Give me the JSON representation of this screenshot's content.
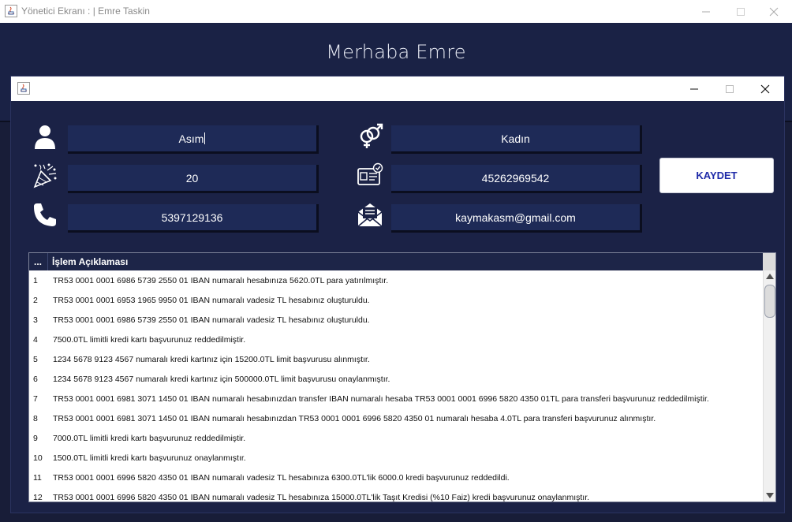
{
  "window": {
    "title": "Yönetici Ekranı : | Emre Taskin",
    "greeting": "Merhaba Emre"
  },
  "form": {
    "name": "Asım",
    "gender": "Kadın",
    "age": "20",
    "tc_no": "45262969542",
    "phone": "5397129136",
    "email": "kaymakasm@gmail.com",
    "save_label": "KAYDET"
  },
  "table": {
    "col_index": "...",
    "col_desc": "İşlem Açıklaması",
    "rows": [
      {
        "n": "1",
        "text": "TR53 0001 0001 6986 5739 2550 01 IBAN numaralı hesabınıza 5620.0TL para yatırılmıştır."
      },
      {
        "n": "2",
        "text": "TR53 0001 0001 6953 1965 9950 01 IBAN numaralı vadesiz TL hesabınız oluşturuldu."
      },
      {
        "n": "3",
        "text": "TR53 0001 0001 6986 5739 2550 01 IBAN numaralı vadesiz TL hesabınız oluşturuldu."
      },
      {
        "n": "4",
        "text": "7500.0TL limitli kredi kartı başvurunuz reddedilmiştir."
      },
      {
        "n": "5",
        "text": "1234 5678 9123 4567 numaralı kredi kartınız için 15200.0TL limit başvurusu alınmıştır."
      },
      {
        "n": "6",
        "text": "1234 5678 9123 4567 numaralı kredi kartınız için 500000.0TL limit başvurusu onaylanmıştır."
      },
      {
        "n": "7",
        "text": "TR53 0001 0001 6981 3071 1450 01 IBAN numaralı hesabınızdan transfer IBAN numaralı hesaba TR53 0001 0001 6996 5820 4350 01TL para transferi başvurunuz reddedilmiştir."
      },
      {
        "n": "8",
        "text": "TR53 0001 0001 6981 3071 1450 01 IBAN numaralı hesabınızdan TR53 0001 0001 6996 5820 4350 01 numaralı hesaba 4.0TL para transferi başvurunuz alınmıştır."
      },
      {
        "n": "9",
        "text": "7000.0TL limitli kredi kartı başvurunuz reddedilmiştir."
      },
      {
        "n": "10",
        "text": "1500.0TL limitli kredi kartı başvurunuz onaylanmıştır."
      },
      {
        "n": "11",
        "text": "TR53 0001 0001 6996 5820 4350 01 IBAN numaralı vadesiz TL hesabınıza 6300.0TL'lik 6000.0 kredi başvurunuz reddedildi."
      },
      {
        "n": "12",
        "text": "TR53 0001 0001 6996 5820 4350 01 IBAN numaralı vadesiz TL hesabınıza 15000.0TL'lik Taşıt Kredisi (%10 Faiz) kredi başvurunuz onaylanmıştır."
      }
    ]
  },
  "icons": {
    "user": "user-icon",
    "gender": "gender-icon",
    "age": "celebration-icon",
    "id_card": "id-card-icon",
    "phone": "phone-icon",
    "mail": "mail-icon"
  }
}
